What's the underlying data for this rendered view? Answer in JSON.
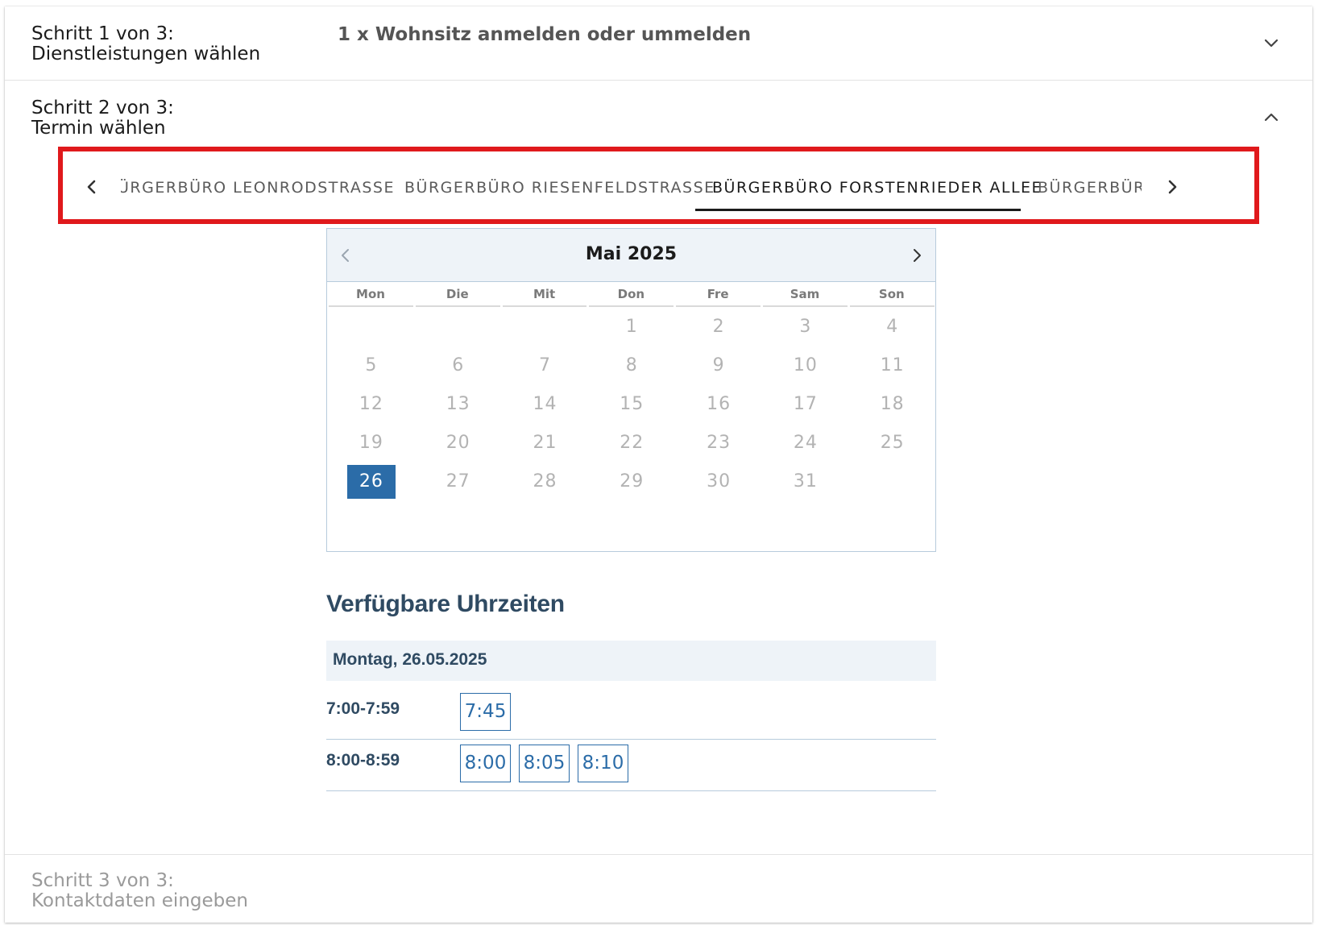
{
  "steps": {
    "step1": {
      "label_line1": "Schritt 1 von 3:",
      "label_line2": "Dienstleistungen wählen",
      "summary": "1 x Wohnsitz anmelden oder ummelden",
      "toggle_icon": "chevron-down-icon"
    },
    "step2": {
      "label_line1": "Schritt 2 von 3:",
      "label_line2": "Termin wählen",
      "toggle_icon": "chevron-up-icon"
    },
    "step3": {
      "label_line1": "Schritt 3 von 3:",
      "label_line2": "Kontaktdaten eingeben"
    }
  },
  "location_tabs": {
    "items": [
      {
        "label": "BÜRGERBÜRO LEONRODSTRASSE",
        "visible_text": "ÜRGERBÜRO LEONRODSTRASSE",
        "active": false
      },
      {
        "label": "BÜRGERBÜRO RIESENFELDSTRASSE",
        "visible_text": "BÜRGERBÜRO RIESENFELDSTRASSE",
        "active": false
      },
      {
        "label": "BÜRGERBÜRO FORSTENRIEDER ALLEE",
        "visible_text": "BÜRGERBÜRO FORSTENRIEDER ALLEE",
        "active": true
      },
      {
        "label": "BÜRGERBÜRO",
        "visible_text": "BÜRGERBÜRO",
        "active": false
      }
    ],
    "highlight_color": "#e0191c"
  },
  "calendar": {
    "month_title": "Mai 2025",
    "weekdays": [
      "Mon",
      "Die",
      "Mit",
      "Don",
      "Fre",
      "Sam",
      "Son"
    ],
    "weeks": [
      [
        "",
        "",
        "",
        "1",
        "2",
        "3",
        "4"
      ],
      [
        "5",
        "6",
        "7",
        "8",
        "9",
        "10",
        "11"
      ],
      [
        "12",
        "13",
        "14",
        "15",
        "16",
        "17",
        "18"
      ],
      [
        "19",
        "20",
        "21",
        "22",
        "23",
        "24",
        "25"
      ],
      [
        "26",
        "27",
        "28",
        "29",
        "30",
        "31",
        ""
      ]
    ],
    "selected_day": "26",
    "selected_color": "#2b6ca8"
  },
  "times": {
    "title": "Verfügbare Uhrzeiten",
    "date_label": "Montag, 26.05.2025",
    "rows": [
      {
        "range": "7:00-7:59",
        "slots": [
          "7:45"
        ]
      },
      {
        "range": "8:00-8:59",
        "slots": [
          "8:00",
          "8:05",
          "8:10"
        ]
      }
    ]
  }
}
